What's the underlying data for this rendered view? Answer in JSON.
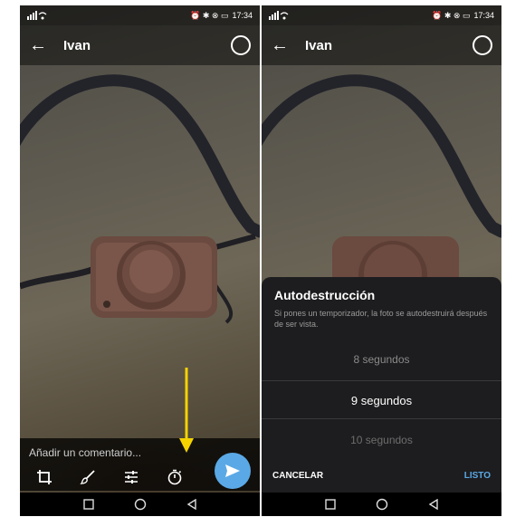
{
  "left_screen": {
    "status": {
      "time": "17:34",
      "icons_left": "signal wifi",
      "icons_right": "alarm bluetooth mute battery"
    },
    "header": {
      "back_icon": "arrow-left-icon",
      "contact_name": "Ivan",
      "select_icon": "circle-select-icon"
    },
    "caption": {
      "placeholder": "Añadir un comentario..."
    },
    "tools": [
      {
        "name": "crop",
        "icon": "crop-icon"
      },
      {
        "name": "draw",
        "icon": "brush-icon"
      },
      {
        "name": "adjust",
        "icon": "sliders-icon"
      },
      {
        "name": "timer",
        "icon": "timer-icon"
      }
    ],
    "send_icon": "send-icon",
    "annotation": {
      "type": "arrow",
      "color": "#f5d300"
    }
  },
  "right_screen": {
    "status": {
      "time": "17:34"
    },
    "header": {
      "contact_name": "Ivan"
    },
    "dialog": {
      "title": "Autodestrucción",
      "description": "Si pones un temporizador, la foto se autodestruirá después de ser vista.",
      "options": [
        "8 segundos",
        "9 segundos",
        "10 segundos"
      ],
      "selected": "9 segundos",
      "cancel_label": "CANCELAR",
      "done_label": "LISTO"
    }
  },
  "nav": {
    "icons": [
      "square-icon",
      "circle-home-icon",
      "triangle-back-icon"
    ]
  },
  "colors": {
    "accent": "#5aa9e6",
    "arrow": "#f5d300",
    "dialog_bg": "#1d1d1f"
  }
}
